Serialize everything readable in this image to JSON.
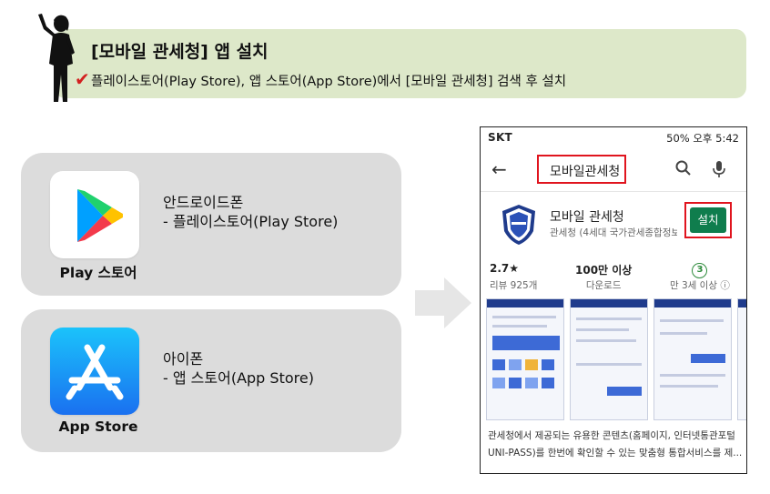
{
  "header": {
    "title": "[모바일 관세청] 앱 설치",
    "subtitle": "플레이스토어(Play Store), 앱 스토어(App Store)에서 [모바일 관세청] 검색 후 설치"
  },
  "cards": [
    {
      "icon": "google-play-icon",
      "label": "Play 스토어",
      "line1": "안드로이드폰",
      "line2": "- 플레이스토어(Play Store)"
    },
    {
      "icon": "app-store-icon",
      "label": "App Store",
      "line1": "아이폰",
      "line2": "- 앱 스토어(App Store)"
    }
  ],
  "phone": {
    "status_left": "SKT",
    "status_right": "50%  오후 5:42",
    "search_text": "모바일관세청",
    "app_name": "모바일 관세청",
    "app_developer": "관세청 (4세대 국가관세종합정보...",
    "install_label": "설치",
    "stats": {
      "rating": "2.7★",
      "reviews": "리뷰 925개",
      "downloads": "100만 이상",
      "downloads_label": "다운로드",
      "age": "3",
      "age_label": "만 3세 이상 ⓘ"
    },
    "description": "관세청에서 제공되는 유용한 콘텐츠(홈페이지, 인터넷통관포털 UNI-PASS)를 한번에 확인할 수 있는 맞춤형 통합서비스를 제..."
  },
  "colors": {
    "banner_bg": "#dde8c9",
    "card_bg": "#dcdcdc",
    "highlight_red": "#e0141e",
    "install_green": "#0f7d4d"
  }
}
